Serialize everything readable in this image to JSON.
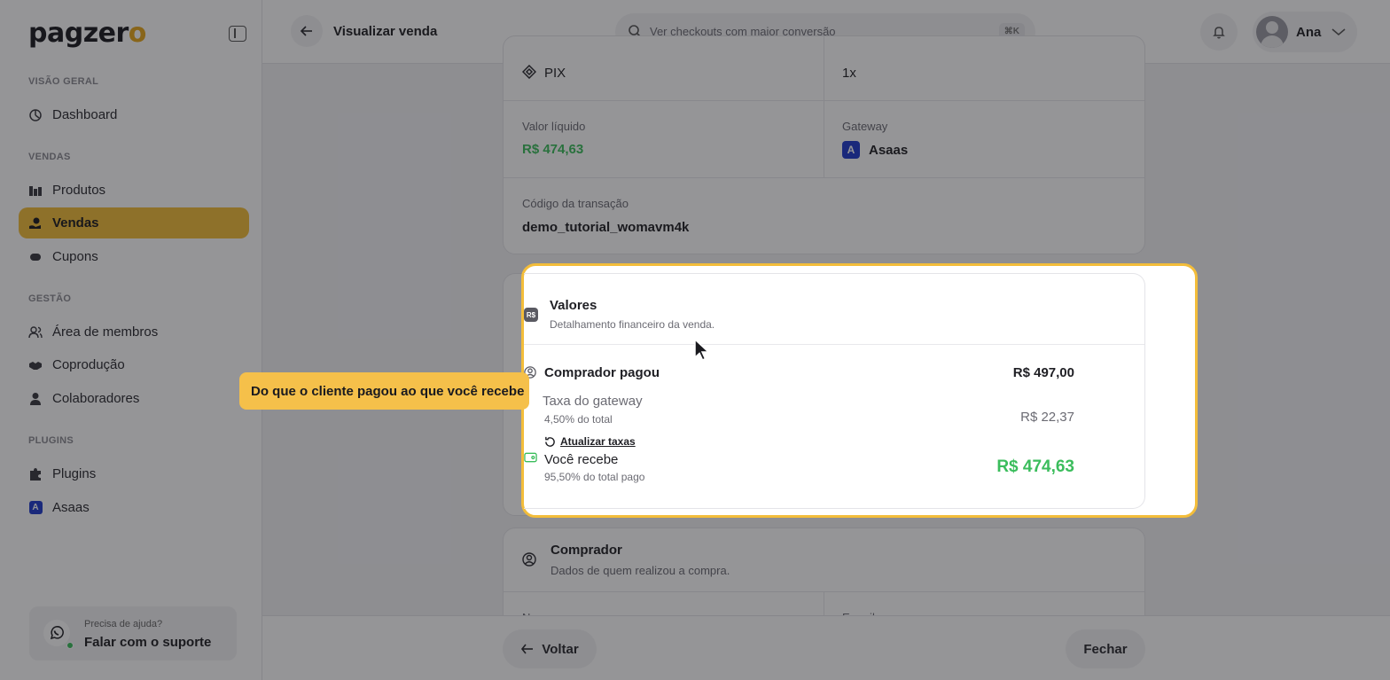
{
  "brand": {
    "logo_main": "pagzer",
    "logo_tail": "o"
  },
  "sidebar": {
    "sections": [
      {
        "label": "VISÃO GERAL",
        "items": [
          {
            "label": "Dashboard",
            "icon": "dashboard-icon"
          }
        ]
      },
      {
        "label": "VENDAS",
        "items": [
          {
            "label": "Produtos",
            "icon": "products-icon"
          },
          {
            "label": "Vendas",
            "icon": "sales-icon",
            "active": true
          },
          {
            "label": "Cupons",
            "icon": "coupon-icon"
          }
        ]
      },
      {
        "label": "GESTÃO",
        "items": [
          {
            "label": "Área de membros",
            "icon": "members-icon"
          },
          {
            "label": "Coprodução",
            "icon": "handshake-icon"
          },
          {
            "label": "Colaboradores",
            "icon": "user-icon"
          }
        ]
      },
      {
        "label": "PLUGINS",
        "items": [
          {
            "label": "Plugins",
            "icon": "puzzle-icon"
          },
          {
            "label": "Asaas",
            "icon": "asaas-icon"
          }
        ]
      }
    ],
    "support": {
      "small": "Precisa de ajuda?",
      "big": "Falar com o suporte"
    }
  },
  "topbar": {
    "title": "Visualizar venda",
    "search_placeholder": "Ver checkouts com maior conversão",
    "shortcut": "⌘K",
    "user_name": "Ana"
  },
  "details": {
    "payment_method": "PIX",
    "installments": "1x",
    "net_label": "Valor líquido",
    "net_value": "R$ 474,63",
    "gateway_label": "Gateway",
    "gateway_value": "Asaas",
    "transaction_label": "Código da transação",
    "transaction_value": "demo_tutorial_womavm4k"
  },
  "valores": {
    "badge": "R$",
    "title": "Valores",
    "subtitle": "Detalhamento financeiro da venda.",
    "buyer_paid_label": "Comprador pagou",
    "buyer_paid_value": "R$ 497,00",
    "fee_label": "Taxa do gateway",
    "fee_sub": "4,50% do total",
    "fee_value": "R$ 22,37",
    "refresh_label": "Atualizar taxas",
    "receive_label": "Você recebe",
    "receive_sub": "95,50% do total pago",
    "receive_value": "R$ 474,63"
  },
  "comprador": {
    "title": "Comprador",
    "subtitle": "Dados de quem realizou a compra.",
    "name_label": "Nome",
    "email_label": "E-mail"
  },
  "tooltip": "Do que o cliente pagou ao que você recebe",
  "actions": {
    "back": "Voltar",
    "close": "Fechar"
  },
  "colors": {
    "accent": "#f3bd3a",
    "positive": "#3bbd5c",
    "gateway": "#1f3bcc"
  }
}
